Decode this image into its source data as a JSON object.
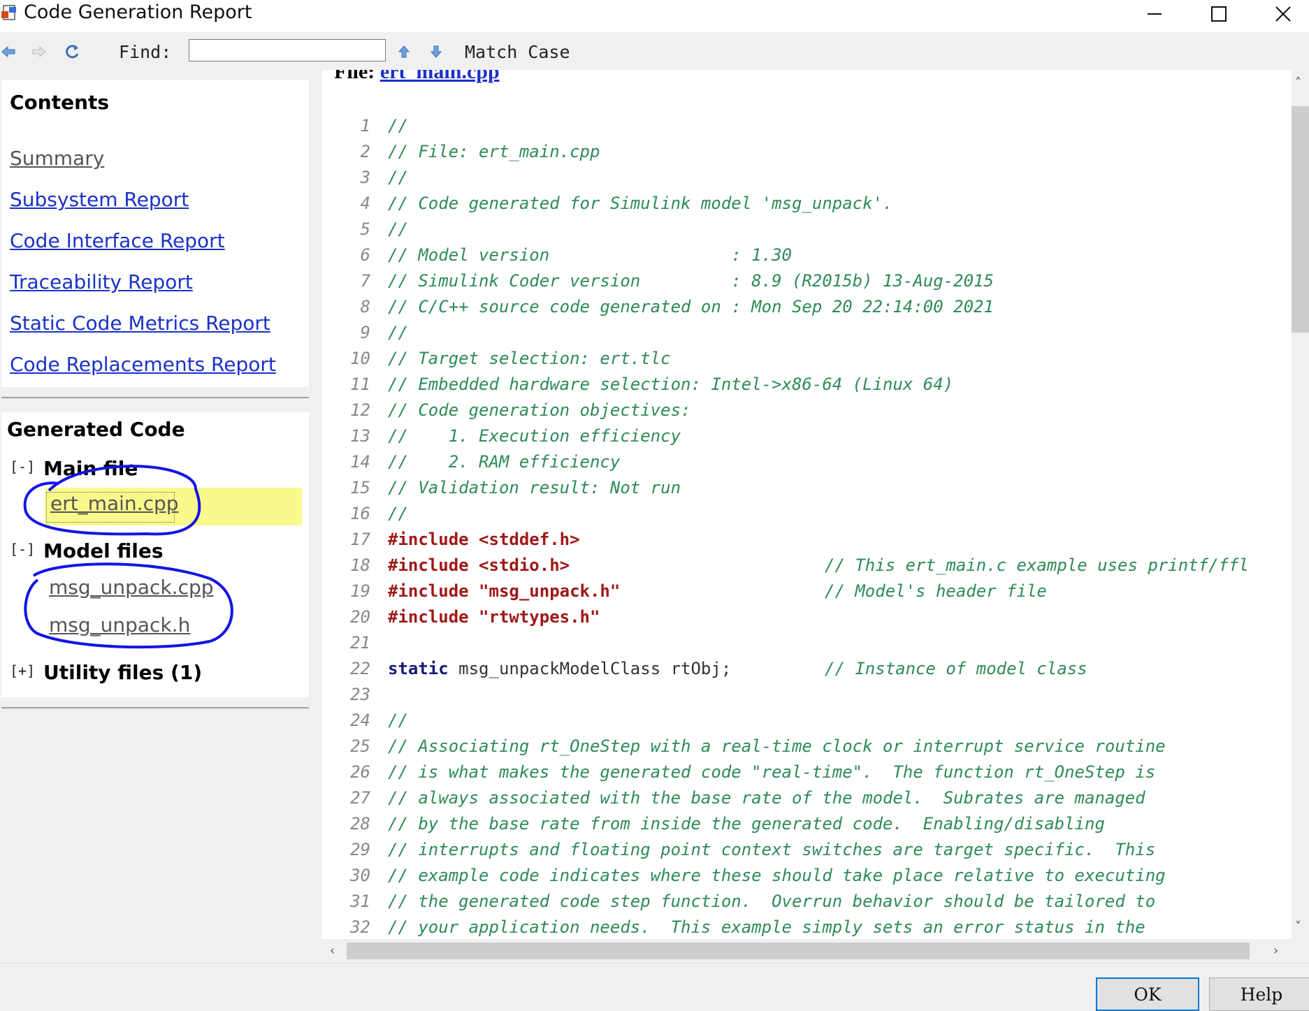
{
  "window": {
    "title": "Code Generation Report"
  },
  "toolbar": {
    "find_label": "Find:",
    "find_value": "",
    "match_case": "Match Case"
  },
  "contents": {
    "heading": "Contents",
    "links": [
      "Summary",
      "Subsystem Report",
      "Code Interface Report",
      "Traceability Report",
      "Static Code Metrics Report",
      "Code Replacements Report"
    ]
  },
  "generated": {
    "heading": "Generated Code",
    "main": {
      "toggle": "[-]",
      "label": "Main file",
      "files": [
        "ert_main.cpp"
      ]
    },
    "model": {
      "toggle": "[-]",
      "label": "Model files",
      "files": [
        "msg_unpack.cpp",
        "msg_unpack.h"
      ]
    },
    "utility": {
      "toggle": "[+]",
      "label": "Utility files (1)"
    }
  },
  "file_view": {
    "label": "File:",
    "file": "ert_main.cpp",
    "lines": [
      {
        "n": "1",
        "code": "//"
      },
      {
        "n": "2",
        "code": "// File: ert_main.cpp"
      },
      {
        "n": "3",
        "code": "//"
      },
      {
        "n": "4",
        "code": "// Code generated for Simulink model 'msg_unpack'."
      },
      {
        "n": "5",
        "code": "//"
      },
      {
        "n": "6",
        "code": "// Model version                  : 1.30"
      },
      {
        "n": "7",
        "code": "// Simulink Coder version         : 8.9 (R2015b) 13-Aug-2015"
      },
      {
        "n": "8",
        "code": "// C/C++ source code generated on : Mon Sep 20 22:14:00 2021"
      },
      {
        "n": "9",
        "code": "//"
      },
      {
        "n": "10",
        "code": "// Target selection: ert.tlc"
      },
      {
        "n": "11",
        "code": "// Embedded hardware selection: Intel->x86-64 (Linux 64)"
      },
      {
        "n": "12",
        "code": "// Code generation objectives:"
      },
      {
        "n": "13",
        "code": "//    1. Execution efficiency"
      },
      {
        "n": "14",
        "code": "//    2. RAM efficiency"
      },
      {
        "n": "15",
        "code": "// Validation result: Not run"
      },
      {
        "n": "16",
        "code": "//"
      },
      {
        "n": "17",
        "pp": "#include",
        "arg": " <stddef.h>"
      },
      {
        "n": "18",
        "pp": "#include",
        "arg": " <stdio.h>",
        "comment": "// This ert_main.c example uses printf/ffl"
      },
      {
        "n": "19",
        "pp": "#include",
        "arg": " \"msg_unpack.h\"",
        "comment": "// Model's header file"
      },
      {
        "n": "20",
        "pp": "#include",
        "arg": " \"rtwtypes.h\""
      },
      {
        "n": "21",
        "code": ""
      },
      {
        "n": "22",
        "kw": "static",
        "arg": " msg_unpackModelClass rtObj;",
        "comment": "// Instance of model class"
      },
      {
        "n": "23",
        "code": ""
      },
      {
        "n": "24",
        "code": "//"
      },
      {
        "n": "25",
        "code": "// Associating rt_OneStep with a real-time clock or interrupt service routine"
      },
      {
        "n": "26",
        "code": "// is what makes the generated code \"real-time\".  The function rt_OneStep is"
      },
      {
        "n": "27",
        "code": "// always associated with the base rate of the model.  Subrates are managed"
      },
      {
        "n": "28",
        "code": "// by the base rate from inside the generated code.  Enabling/disabling"
      },
      {
        "n": "29",
        "code": "// interrupts and floating point context switches are target specific.  This"
      },
      {
        "n": "30",
        "code": "// example code indicates where these should take place relative to executing"
      },
      {
        "n": "31",
        "code": "// the generated code step function.  Overrun behavior should be tailored to"
      },
      {
        "n": "32",
        "code": "// your application needs.  This example simply sets an error status in the"
      }
    ]
  },
  "buttons": {
    "ok": "OK",
    "help": "Help"
  },
  "colors": {
    "link": "#1a32c8",
    "comment": "#2e8b57",
    "preprocessor": "#a01818",
    "highlight": "#fafa8c",
    "annotation": "#1414e6"
  }
}
